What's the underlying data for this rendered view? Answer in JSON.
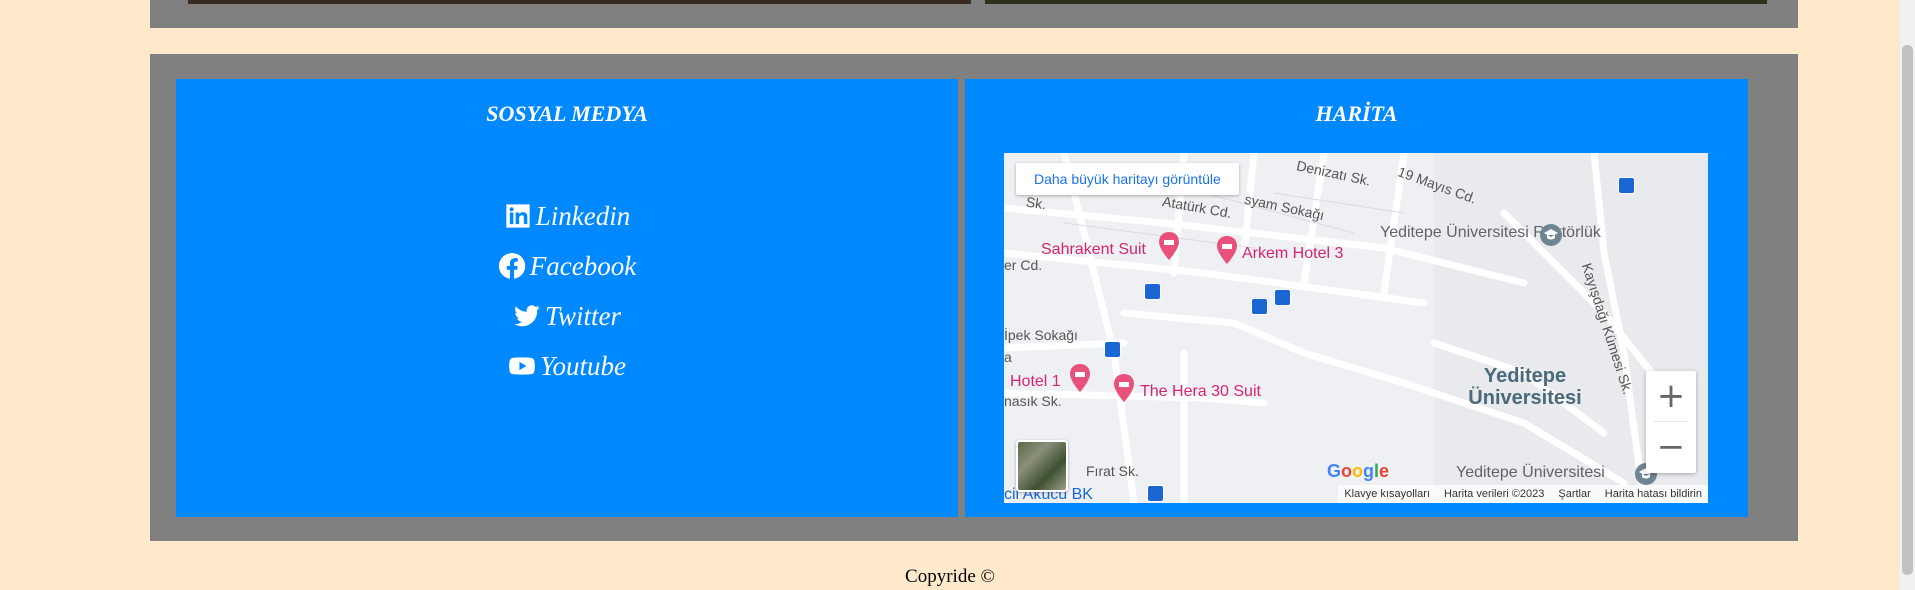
{
  "social": {
    "title": "SOSYAL MEDYA",
    "links": [
      {
        "label": "Linkedin",
        "icon": "linkedin-icon"
      },
      {
        "label": "Facebook",
        "icon": "facebook-icon"
      },
      {
        "label": "Twitter",
        "icon": "twitter-icon"
      },
      {
        "label": "Youtube",
        "icon": "youtube-icon"
      }
    ]
  },
  "map": {
    "title": "HARİTA",
    "view_larger": "Daha büyük haritayı görüntüle",
    "labels": {
      "denizati": "Denizatı Sk.",
      "mayis": "19 Mayıs Cd.",
      "ataturk": "Atatürk Cd.",
      "sk": "Sk.",
      "yesyam": "syam Sokağı",
      "cd": "er Cd.",
      "ipek": "İpek Sokağı",
      "a": "a",
      "nasik": "nasık Sk.",
      "firat": "Fırat Sk.",
      "kayisdagi": "Kayışdağı Kümesi Sk.",
      "rektorluk": "Yeditepe Üniversitesi Rektörlük",
      "yu2": "Yeditepe Üniversitesi"
    },
    "places": {
      "sahrakent": "Sahrakent Suit",
      "arkem": "Arkem Hotel 3",
      "hotel1": "Hotel 1",
      "hera": "The Hera 30 Suit",
      "akucu": "cil Akücü BK"
    },
    "university": "Yeditepe Üniversitesi",
    "zoom_in": "+",
    "zoom_out": "−",
    "google": "Google",
    "attribution": {
      "shortcuts": "Klavye kısayolları",
      "data": "Harita verileri ©2023",
      "terms": "Şartlar",
      "report": "Harita hatası bildirin"
    }
  },
  "footer": {
    "copyright": "Copyride ©"
  }
}
